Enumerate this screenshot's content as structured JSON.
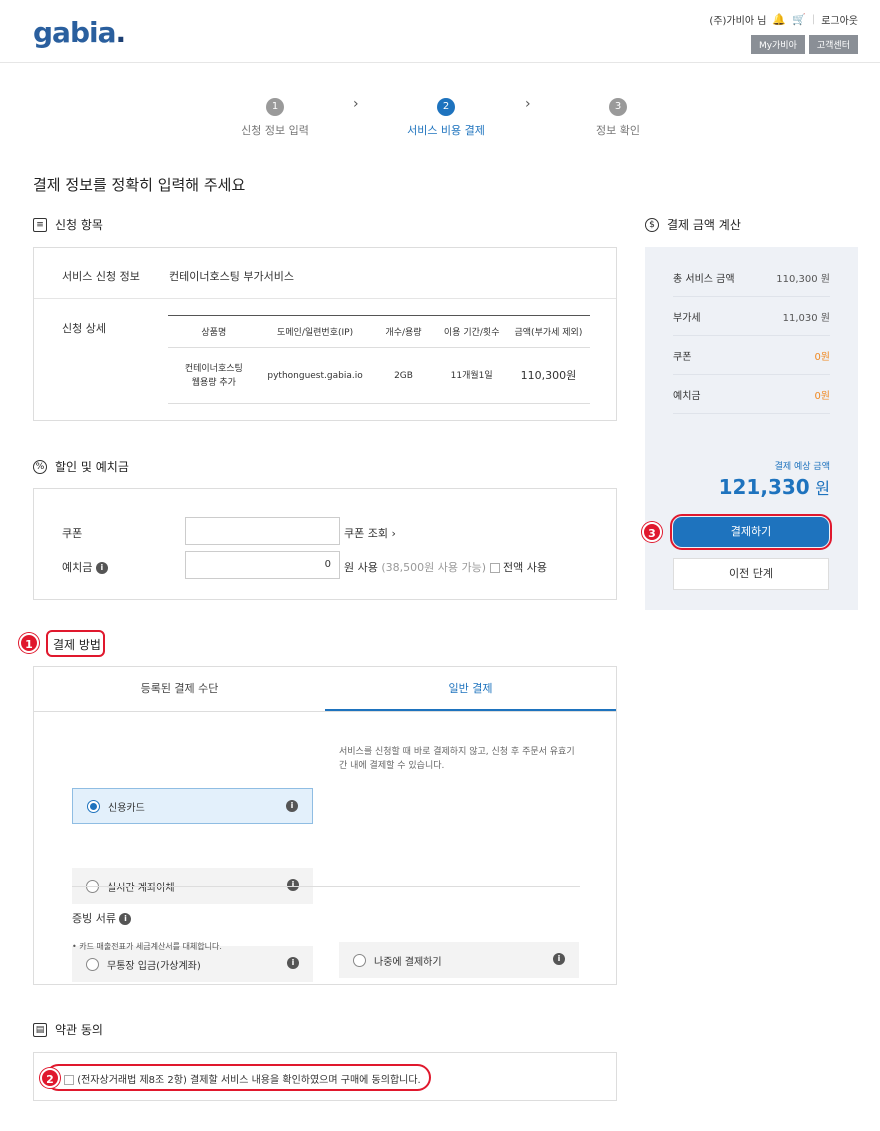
{
  "header": {
    "logo": "gabia",
    "logo_dot": ".",
    "user": "(주)가비아 님",
    "logout": "로그아웃",
    "mygabia": "My가비아",
    "customer_center": "고객센터"
  },
  "steps": [
    {
      "num": "1",
      "label": "신청 정보 입력"
    },
    {
      "num": "2",
      "label": "서비스 비용 결제"
    },
    {
      "num": "3",
      "label": "정보 확인"
    }
  ],
  "page_title": "결제 정보를 정확히 입력해 주세요",
  "order": {
    "section_title": "신청 항목",
    "service_label": "서비스 신청 정보",
    "service_value": "컨테이너호스팅 부가서비스",
    "detail_label": "신청 상세",
    "columns": [
      "상품명",
      "도메인/일련번호(IP)",
      "개수/용량",
      "이용 기간/횟수",
      "금액(부가세 제외)"
    ],
    "row": {
      "product_line1": "컨테이너호스팅",
      "product_line2": "웹용량 추가",
      "domain": "pythonguest.gabia.io",
      "qty": "2GB",
      "period": "11개월1일",
      "amount": "110,300원"
    }
  },
  "discount": {
    "section_title": "할인 및 예치금",
    "coupon_label": "쿠폰",
    "coupon_value": "",
    "coupon_link": "쿠폰 조회",
    "deposit_label": "예치금",
    "deposit_value": "0",
    "deposit_unit": "원 사용",
    "deposit_available": "(38,500원 사용 가능)",
    "deposit_all": "전액 사용"
  },
  "payment": {
    "section_title": "결제 방법",
    "tabs": [
      "등록된 결제 수단",
      "일반 결제"
    ],
    "options": [
      "신용카드",
      "실시간 계좌이체",
      "무통장 입금(가상계좌)"
    ],
    "later_note": "서비스를 신청할 때 바로 결제하지 않고, 신청 후 주문서 유효기간 내에 결제할 수 있습니다.",
    "later_option": "나중에 결제하기",
    "receipt_label": "증빙 서류",
    "receipt_note": "• 카드 매출전표가 세금계산서를 대체합니다."
  },
  "terms": {
    "section_title": "약관 동의",
    "agree_text": "(전자상거래법 제8조 2항) 결제할 서비스 내용을 확인하였으며 구매에 동의합니다."
  },
  "summary": {
    "section_title": "결제 금액 계산",
    "rows": [
      {
        "label": "총 서비스 금액",
        "value": "110,300 원"
      },
      {
        "label": "부가세",
        "value": "11,030 원"
      },
      {
        "label": "쿠폰",
        "value": "0원"
      },
      {
        "label": "예치금",
        "value": "0원"
      }
    ],
    "expected_label": "결제 예상 금액",
    "expected_value": "121,330",
    "expected_unit": "원",
    "pay_button": "결제하기",
    "prev_button": "이전 단계"
  },
  "badges": [
    "1",
    "2",
    "3"
  ],
  "colors": {
    "accent": "#1e73be",
    "highlight": "#e0182d",
    "orange": "#f08a24"
  }
}
